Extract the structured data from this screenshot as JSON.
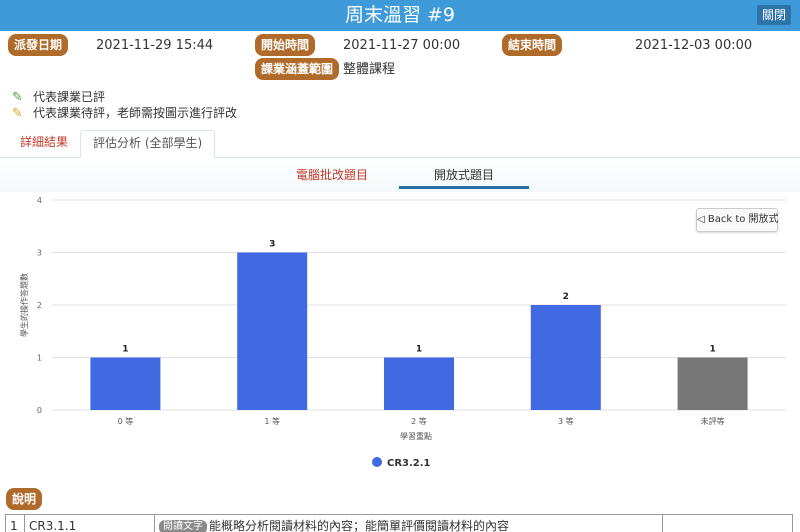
{
  "window": {
    "title": "周末溫習 #9",
    "close_label": "關閉"
  },
  "meta": {
    "dispatch_label": "派發日期",
    "dispatch_value": "2021-11-29 15:44",
    "start_label": "開始時間",
    "start_value": "2021-11-27 00:00",
    "end_label": "結束時間",
    "end_value": "2021-12-03 00:00",
    "scope_label": "課業涵蓋範圍",
    "scope_value": "整體課程"
  },
  "legend": {
    "graded": "代表課業已評",
    "pending": "代表課業待評，老師需按圖示進行評改"
  },
  "tabs": {
    "details": "詳細結果",
    "analysis": "評估分析 (全部學生)"
  },
  "subtabs": {
    "auto": "電腦批改題目",
    "open": "開放式題目"
  },
  "back_button": "◁ Back to 開放式",
  "chart_data": {
    "type": "bar",
    "categories": [
      "0 等",
      "1 等",
      "2 等",
      "3 等",
      "未評等"
    ],
    "values": [
      1,
      3,
      1,
      2,
      1
    ],
    "bar_colors": [
      "#4169e1",
      "#4169e1",
      "#4169e1",
      "#4169e1",
      "#777777"
    ],
    "xlabel": "學習重點",
    "ylabel": "學生的操作答題數",
    "ylim": [
      0,
      4
    ],
    "yticks": [
      0,
      1,
      2,
      3,
      4
    ],
    "legend": [
      {
        "name": "CR3.2.1",
        "color": "#4169e1"
      }
    ],
    "legend_position": "bottom",
    "grid": true
  },
  "explain_label": "說明",
  "table": {
    "rows": [
      {
        "num": "1",
        "code": "CR3.1.1",
        "tag": "閱讀文字",
        "text": "能概略分析閱讀材料的內容；能簡單評價閱讀材料的內容",
        "extra": ""
      }
    ]
  },
  "colors": {
    "header": "#3e9ad8",
    "badge": "#b06a2a",
    "bar": "#4169e1",
    "ungraded": "#777777"
  }
}
